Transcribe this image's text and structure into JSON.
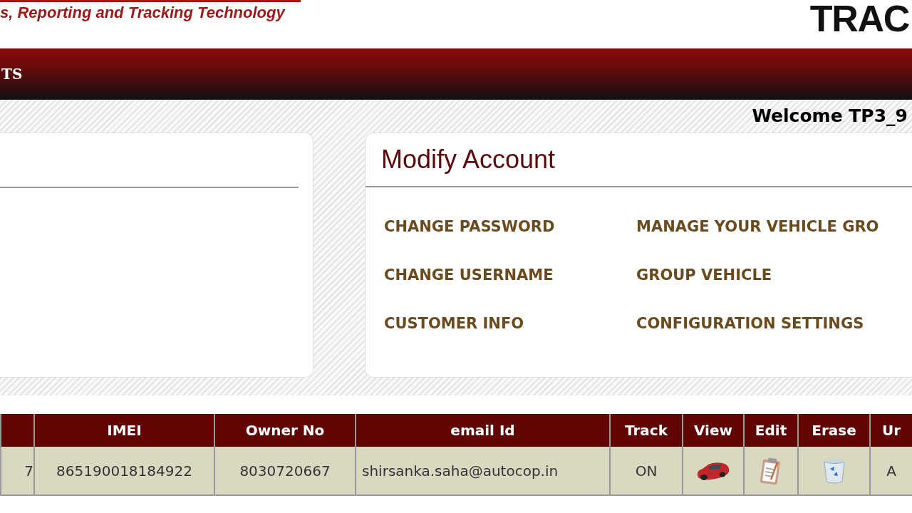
{
  "header": {
    "tagline": "s, Reporting and Tracking Technology",
    "logo_text": "TRAC"
  },
  "nav": {
    "items": [
      {
        "label": "TS"
      }
    ]
  },
  "welcome": "Welcome TP3_9",
  "modify_account": {
    "title": "Modify Account",
    "links": [
      {
        "label": "CHANGE PASSWORD"
      },
      {
        "label": "MANAGE YOUR VEHICLE GRO"
      },
      {
        "label": "CHANGE USERNAME"
      },
      {
        "label": "GROUP VEHICLE"
      },
      {
        "label": "CUSTOMER INFO"
      },
      {
        "label": "CONFIGURATION SETTINGS"
      }
    ]
  },
  "table": {
    "columns": [
      "",
      "IMEI",
      "Owner No",
      "email Id",
      "Track",
      "View",
      "Edit",
      "Erase",
      "Ur"
    ],
    "rows": [
      {
        "cells": [
          {
            "kind": "text",
            "text": "7"
          },
          {
            "kind": "text",
            "text": "865190018184922"
          },
          {
            "kind": "text",
            "text": "8030720667"
          },
          {
            "kind": "text",
            "text": "shirsanka.saha@autocop.in"
          },
          {
            "kind": "text",
            "text": "ON"
          },
          {
            "kind": "view"
          },
          {
            "kind": "edit"
          },
          {
            "kind": "erase"
          },
          {
            "kind": "text",
            "text": "A"
          }
        ]
      }
    ]
  }
}
